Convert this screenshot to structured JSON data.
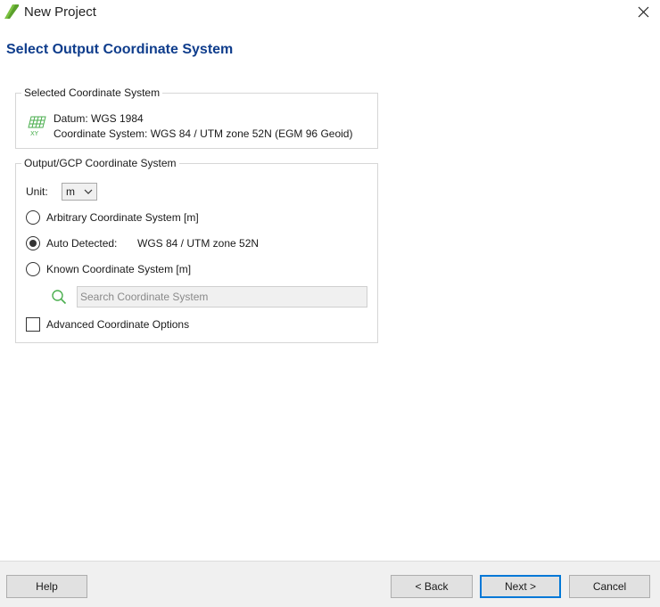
{
  "window": {
    "title": "New Project",
    "app_icon": "app-leaf-icon",
    "close_icon": "close-icon",
    "accent_color": "#0f3d8c",
    "focus_color": "#0078d7",
    "icon_green": "#4caf50"
  },
  "page": {
    "heading": "Select Output Coordinate System"
  },
  "selected_cs": {
    "legend": "Selected Coordinate System",
    "icon": "coordinate-grid-icon",
    "datum": "Datum: WGS 1984",
    "coordinate_system": "Coordinate System: WGS 84 / UTM zone 52N (EGM 96 Geoid)"
  },
  "output_cs": {
    "legend": "Output/GCP Coordinate System",
    "unit_label": "Unit:",
    "unit_value": "m",
    "options": [
      {
        "label": "Arbitrary Coordinate System [m]",
        "selected": false
      },
      {
        "label": "Auto Detected:",
        "value": "WGS 84 / UTM zone 52N",
        "selected": true
      },
      {
        "label": "Known Coordinate System [m]",
        "selected": false
      }
    ],
    "search_placeholder": "Search Coordinate System",
    "advanced_label": "Advanced Coordinate Options",
    "advanced_checked": false
  },
  "footer": {
    "help": "Help",
    "back": "< Back",
    "next": "Next >",
    "cancel": "Cancel"
  }
}
